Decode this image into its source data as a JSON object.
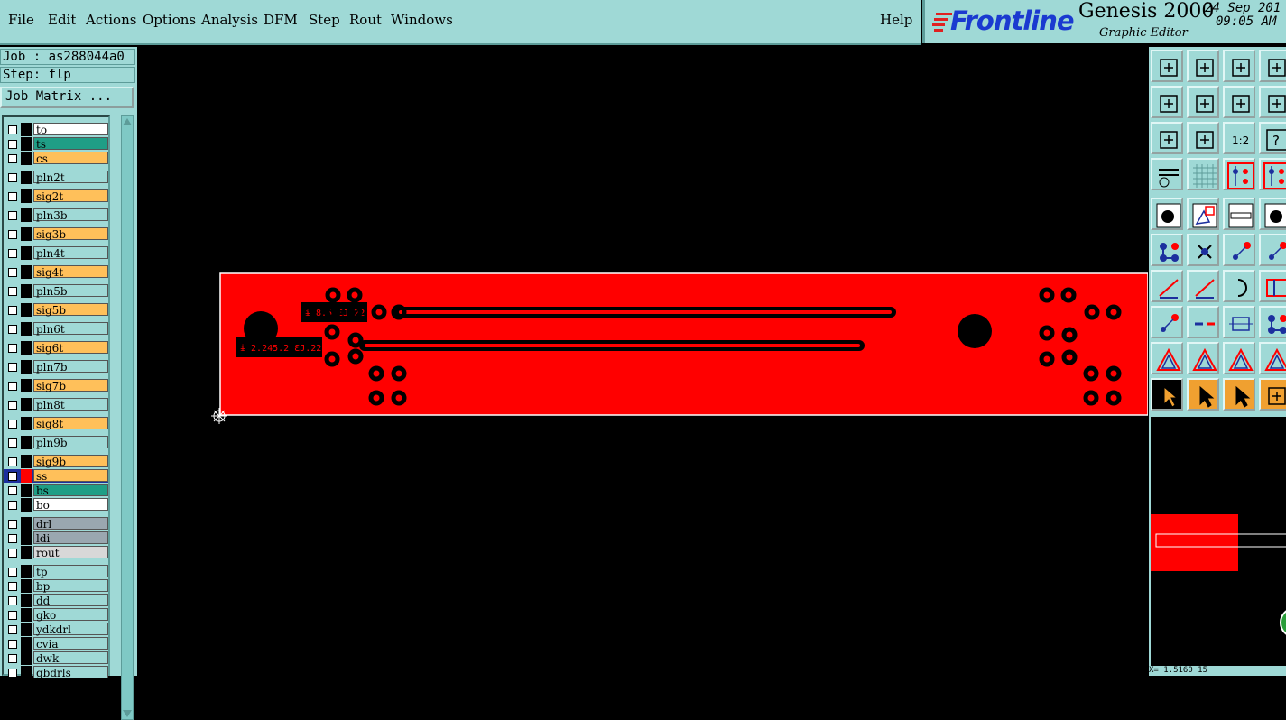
{
  "menubar": {
    "items": [
      "File",
      "Edit",
      "Actions",
      "Options",
      "Analysis",
      "DFM",
      "Step",
      "Rout",
      "Windows"
    ],
    "help": "Help"
  },
  "brand": {
    "logo": "Frontline",
    "title": "Genesis 2000",
    "subtitle": "Graphic Editor",
    "date": "24 Sep 201",
    "time": "09:05 AM"
  },
  "job": {
    "job_label": "Job : as288044a0",
    "step_label": "Step: flp",
    "matrix_button": "Job Matrix ..."
  },
  "layers": [
    {
      "name": "to",
      "color": "#ffffff"
    },
    {
      "name": "ts",
      "color": "#1f9e86"
    },
    {
      "name": "cs",
      "color": "#ffc05a"
    },
    {
      "name": "pln2t",
      "color": "#9fd9d6"
    },
    {
      "name": "sig2t",
      "color": "#ffc05a"
    },
    {
      "name": "pln3b",
      "color": "#9fd9d6"
    },
    {
      "name": "sig3b",
      "color": "#ffc05a"
    },
    {
      "name": "pln4t",
      "color": "#9fd9d6"
    },
    {
      "name": "sig4t",
      "color": "#ffc05a"
    },
    {
      "name": "pln5b",
      "color": "#9fd9d6"
    },
    {
      "name": "sig5b",
      "color": "#ffc05a"
    },
    {
      "name": "pln6t",
      "color": "#9fd9d6"
    },
    {
      "name": "sig6t",
      "color": "#ffc05a"
    },
    {
      "name": "pln7b",
      "color": "#9fd9d6"
    },
    {
      "name": "sig7b",
      "color": "#ffc05a"
    },
    {
      "name": "pln8t",
      "color": "#9fd9d6"
    },
    {
      "name": "sig8t",
      "color": "#ffc05a"
    },
    {
      "name": "pln9b",
      "color": "#9fd9d6"
    },
    {
      "name": "sig9b",
      "color": "#ffc05a"
    },
    {
      "name": "ss",
      "color": "#ffc05a",
      "active": true
    },
    {
      "name": "bs",
      "color": "#1f9e86"
    },
    {
      "name": "bo",
      "color": "#ffffff"
    },
    {
      "name": "drl",
      "color": "#9aa7b0"
    },
    {
      "name": "ldi",
      "color": "#9aa7b0"
    },
    {
      "name": "rout",
      "color": "#d8d8d8"
    },
    {
      "name": "tp",
      "color": "#9fd9d6"
    },
    {
      "name": "bp",
      "color": "#9fd9d6"
    },
    {
      "name": "dd",
      "color": "#9fd9d6"
    },
    {
      "name": "gko",
      "color": "#9fd9d6"
    },
    {
      "name": "ydkdrl",
      "color": "#9fd9d6"
    },
    {
      "name": "cvia",
      "color": "#9fd9d6"
    },
    {
      "name": "dwk",
      "color": "#9fd9d6"
    },
    {
      "name": "gbdrls",
      "color": "#9fd9d6"
    }
  ],
  "board": {
    "fill_color": "#ff0000",
    "text_top": "ɨ 8.5 ƐJ.22",
    "text_bottom": "ɨ 2.245.2 ƐJ.22"
  },
  "toolbar": {
    "icons": [
      "zoom-page-icon",
      "zoom-down-icon",
      "home-icon",
      "grid-window-icon",
      "pan-left-icon",
      "pan-right-icon",
      "undo-zoom-icon",
      "snap-icon",
      "fit-vertical-icon",
      "fit-center-icon",
      "ratio-icon",
      "help-icon",
      "settings-icon",
      "grid-icon",
      "measure-nets-icon",
      "nets-icon",
      "add-pad-icon",
      "move-icon",
      "ruler-icon",
      "pad-select-icon",
      "net-connect-icon",
      "delete-icon",
      "snap-point-icon",
      "snap-point2-icon",
      "line-icon",
      "line-move-icon",
      "arc-icon",
      "slot-icon",
      "point-move-icon",
      "break-icon",
      "center-icon",
      "circle-group-icon",
      "triangle-icon",
      "triangle-move-icon",
      "triangle-select-icon",
      "triangle-add-icon",
      "select-arrow-icon",
      "select-arrow2-icon",
      "select-arrow3-icon",
      "select-path-icon"
    ],
    "ratio_label": "1:2"
  },
  "status": {
    "coords": "X=  1.5160  15"
  }
}
